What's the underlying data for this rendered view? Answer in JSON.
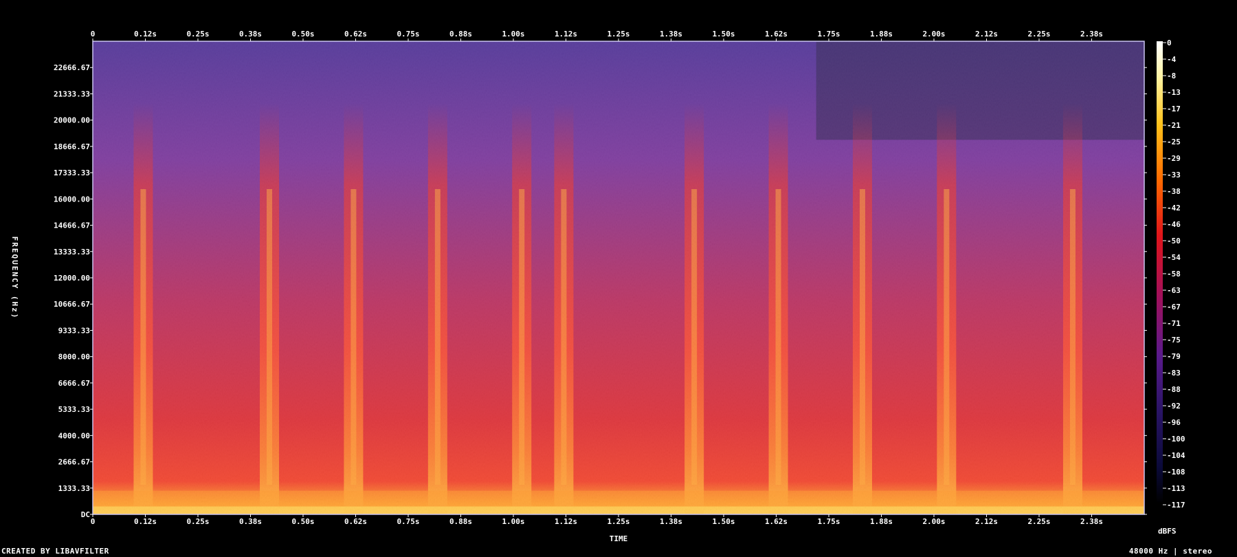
{
  "chart_data": {
    "type": "heatmap",
    "title": "",
    "xlabel": "TIME",
    "ylabel": "FREQUENCY (Hz)",
    "x_ticks": [
      "0",
      "0.12s",
      "0.25s",
      "0.38s",
      "0.50s",
      "0.62s",
      "0.75s",
      "0.88s",
      "1.00s",
      "1.12s",
      "1.25s",
      "1.38s",
      "1.50s",
      "1.62s",
      "1.75s",
      "1.88s",
      "2.00s",
      "2.12s",
      "2.25s",
      "2.38s"
    ],
    "x_tick_values": [
      0,
      0.125,
      0.25,
      0.375,
      0.5,
      0.625,
      0.75,
      0.875,
      1.0,
      1.125,
      1.25,
      1.375,
      1.5,
      1.625,
      1.75,
      1.875,
      2.0,
      2.125,
      2.25,
      2.375
    ],
    "xlim": [
      0,
      2.5
    ],
    "y_ticks": [
      "DC",
      "1333.33",
      "2666.67",
      "4000.00",
      "5333.33",
      "6666.67",
      "8000.00",
      "9333.33",
      "10666.67",
      "12000.00",
      "13333.33",
      "14666.67",
      "16000.00",
      "17333.33",
      "18666.67",
      "20000.00",
      "21333.33",
      "22666.67"
    ],
    "y_tick_values": [
      0,
      1333.33,
      2666.67,
      4000,
      5333.33,
      6666.67,
      8000,
      9333.33,
      10666.67,
      12000,
      13333.33,
      14666.67,
      16000,
      17333.33,
      18666.67,
      20000,
      21333.33,
      22666.67
    ],
    "ylim": [
      0,
      24000
    ],
    "colorbar": {
      "label": "dBFS",
      "ticks": [
        "0",
        "-4",
        "-8",
        "-13",
        "-17",
        "-21",
        "-25",
        "-29",
        "-33",
        "-38",
        "-42",
        "-46",
        "-50",
        "-54",
        "-58",
        "-63",
        "-67",
        "-71",
        "-75",
        "-79",
        "-83",
        "-88",
        "-92",
        "-96",
        "-100",
        "-104",
        "-108",
        "-113",
        "-117"
      ],
      "range": [
        -120,
        0
      ]
    },
    "transients_s": [
      0.12,
      0.42,
      0.62,
      0.82,
      1.02,
      1.12,
      1.43,
      1.63,
      1.83,
      2.03,
      2.33
    ],
    "grid": false
  },
  "footer": {
    "left": "CREATED BY LIBAVFILTER",
    "right": "48000 Hz | stereo"
  },
  "colors": {
    "background": "#000000",
    "text": "#ffffff",
    "frame": "#c9c3ef"
  }
}
